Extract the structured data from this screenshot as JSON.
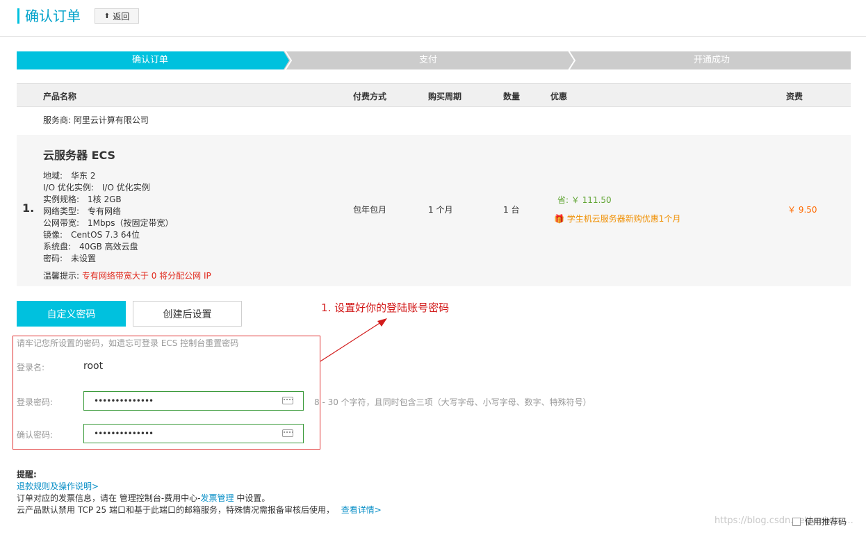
{
  "header": {
    "title": "确认订单",
    "back_label": "返回"
  },
  "steps": [
    {
      "label": "确认订单",
      "active": true
    },
    {
      "label": "支付",
      "active": false
    },
    {
      "label": "开通成功",
      "active": false
    }
  ],
  "table": {
    "headers": {
      "product": "产品名称",
      "payment": "付费方式",
      "period": "购买周期",
      "quantity": "数量",
      "discount": "优惠",
      "fee": "资费"
    },
    "provider": "服务商: 阿里云计算有限公司",
    "row_number": "1.",
    "product_name": "云服务器 ECS",
    "specs": [
      {
        "key": "地域:",
        "value": "华东 2"
      },
      {
        "key": "I/O 优化实例:",
        "value": "I/O 优化实例"
      },
      {
        "key": "实例规格:",
        "value": "1核 2GB"
      },
      {
        "key": "网络类型:",
        "value": "专有网络"
      },
      {
        "key": "公网带宽:",
        "value": "1Mbps（按固定带宽）"
      },
      {
        "key": "镜像:",
        "value": "CentOS 7.3 64位"
      },
      {
        "key": "系统盘:",
        "value": "40GB 高效云盘"
      },
      {
        "key": "密码:",
        "value": "未设置"
      }
    ],
    "tip_label": "温馨提示:",
    "tip_text": "专有网络带宽大于 0 将分配公网 IP",
    "payment": "包年包月",
    "period": "1 个月",
    "quantity": "1 台",
    "save_text": "省: ￥ 111.50",
    "promo_text": "学生机云服务器新购优惠1个月",
    "price": "￥ 9.50"
  },
  "password": {
    "tab_custom": "自定义密码",
    "tab_later": "创建后设置",
    "hint": "请牢记您所设置的密码，如遗忘可登录 ECS 控制台重置密码",
    "login_label": "登录名:",
    "login_value": "root",
    "pw_label": "登录密码:",
    "pw_value": "••••••••••••••",
    "confirm_label": "确认密码:",
    "confirm_value": "••••••••••••••",
    "rule": "8 - 30 个字符，且同时包含三项（大写字母、小写字母、数字、特殊符号）"
  },
  "annotation": "1. 设置好你的登陆账号密码",
  "reminder": {
    "title": "提醒:",
    "refund_link": "退款规则及操作说明>",
    "invoice_pre": "订单对应的发票信息，请在 管理控制台-费用中心-",
    "invoice_link": "发票管理",
    "invoice_post": " 中设置。",
    "port_text": "云产品默认禁用 TCP 25 端口和基于此端口的邮箱服务，特殊情况需报备审核后使用，",
    "port_link": "查看详情>"
  },
  "recommend_label": "使用推荐码",
  "watermark": "https://blog.csdn.net/weixin_...",
  "colors": {
    "accent": "#00c1de",
    "inactive_step": "#cccccc",
    "price": "#ff6a00",
    "save": "#5fa432",
    "promo": "#f08f00",
    "annotation": "#d21b1b"
  }
}
